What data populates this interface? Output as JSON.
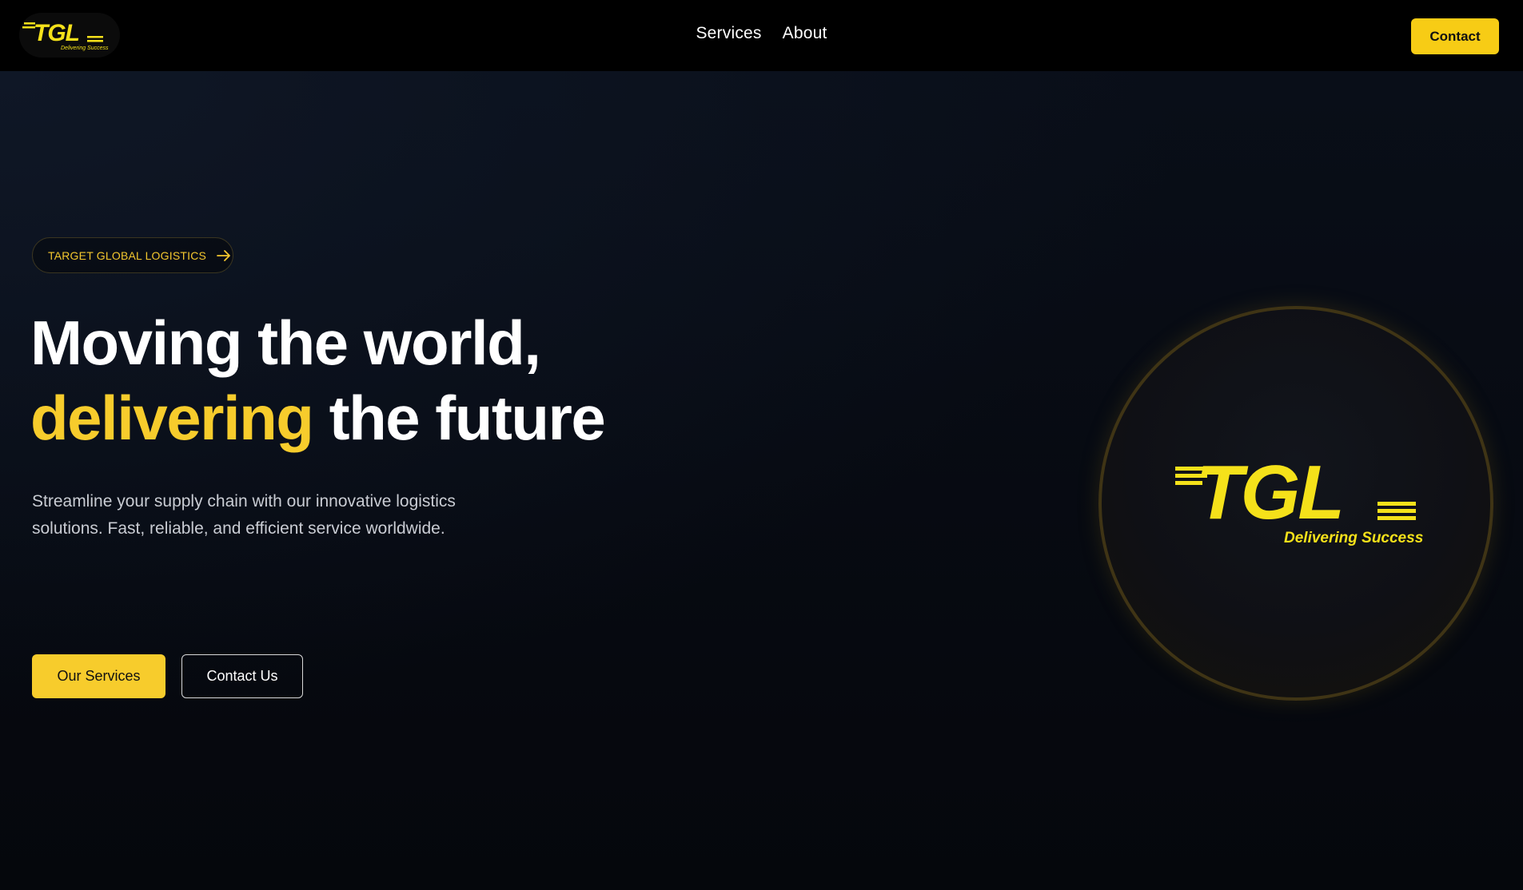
{
  "header": {
    "logo": {
      "wordmark": "TGL",
      "tagline": "Delivering Success"
    },
    "nav": [
      {
        "label": "Services"
      },
      {
        "label": "About"
      }
    ],
    "contact_label": "Contact"
  },
  "hero": {
    "badge_label": "TARGET GLOBAL LOGISTICS",
    "headline_line1": "Moving the world,",
    "headline_accent": "delivering",
    "headline_line2_rest": " the future",
    "subtext_line1": "Streamline your supply chain with our innovative logistics",
    "subtext_line2": "solutions. Fast, reliable, and efficient service worldwide.",
    "primary_button": "Our Services",
    "secondary_button": "Contact Us",
    "logo": {
      "wordmark": "TGL",
      "tagline": "Delivering Success"
    }
  },
  "colors": {
    "accent": "#f7cc2c",
    "header_bg": "#000000",
    "hero_bg": "#05070d",
    "text": "#ffffff",
    "muted_text": "#c9ccd3"
  },
  "icons": [
    "arrow-right-icon"
  ]
}
